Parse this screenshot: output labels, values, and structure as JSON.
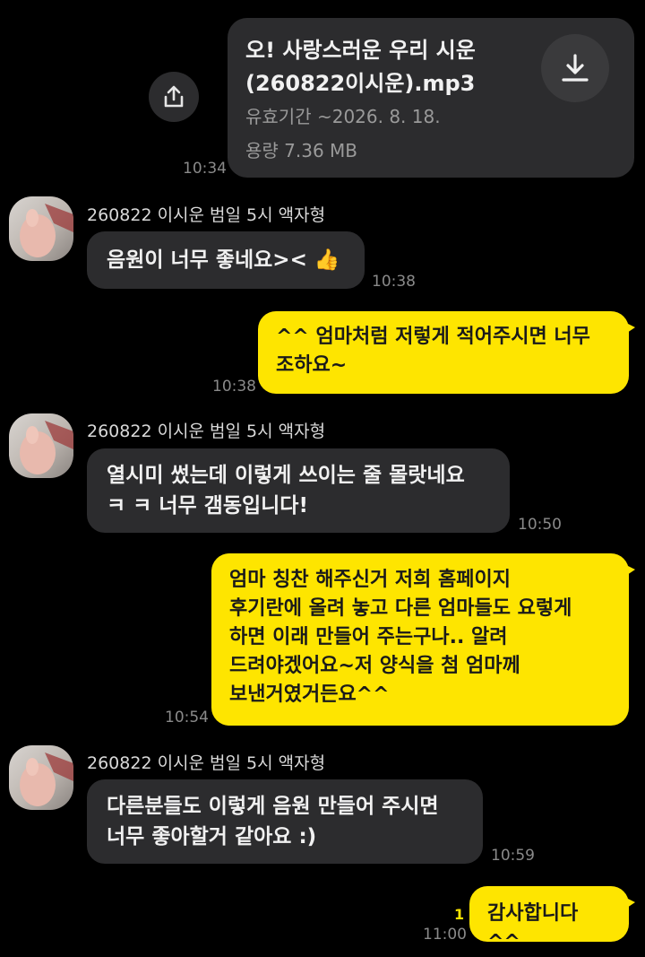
{
  "file_message": {
    "title": "오! 사랑스러운 우리 시운\n(260822이시운).mp3",
    "expiry": "유효기간 ~2026. 8. 18.",
    "size": "용량  7.36 MB",
    "time": "10:34"
  },
  "messages": [
    {
      "sender": "260822 이시운 범일 5시 액자형",
      "text": "음원이 너무 좋네요>< 👍",
      "time": "10:38"
    },
    {
      "text": "^^ 엄마처럼 저렇게 적어주시면 너무\n조하요~",
      "time": "10:38"
    },
    {
      "sender": "260822 이시운 범일 5시 액자형",
      "text": "열시미 썼는데 이렇게 쓰이는 줄 몰랏네요\nㅋ ㅋ 너무 갬동입니다!",
      "time": "10:50"
    },
    {
      "text": "엄마 칭찬 해주신거 저희 홈페이지\n후기란에 올려 놓고 다른 엄마들도 요렇게\n하면 이래 만들어 주는구나.. 알려\n드려야겠어요~저 양식을 첨 엄마께\n보낸거였거든요^^",
      "time": "10:54"
    },
    {
      "sender": "260822 이시운 범일 5시 액자형",
      "text": "다른분들도 이렇게 음원 만들어 주시면\n너무 좋아할거 같아요 :)",
      "time": "10:59"
    },
    {
      "text": "감사합니다 ^^",
      "time": "11:00",
      "unread": "1"
    }
  ]
}
